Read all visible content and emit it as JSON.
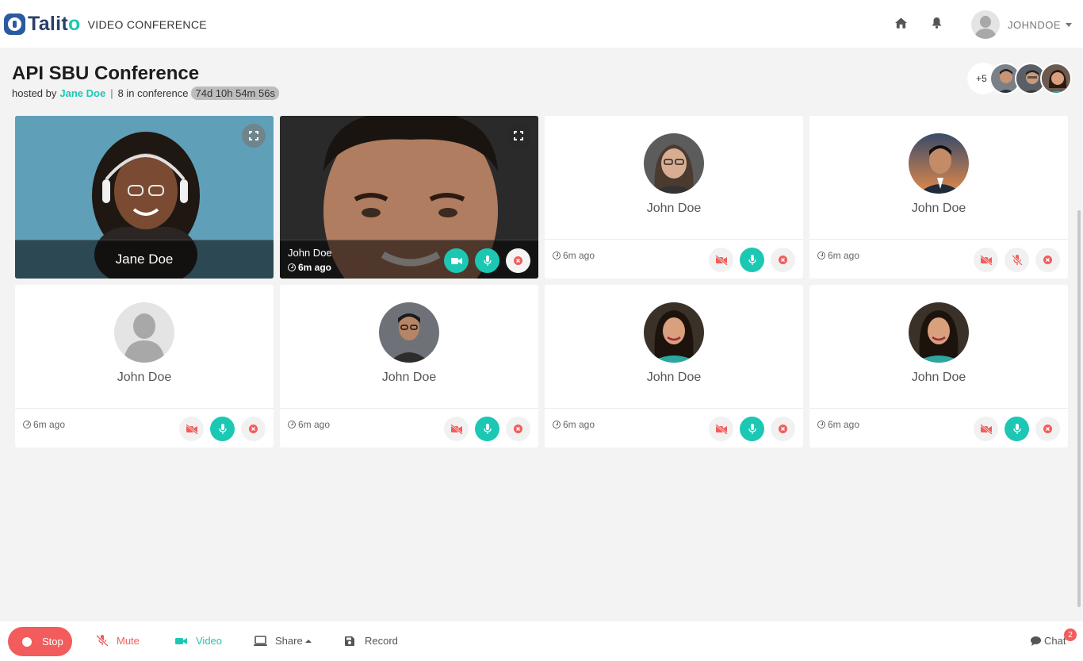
{
  "header": {
    "logo_text_main": "Talit",
    "logo_text_accent": "o",
    "app_label": "VIDEO CONFERENCE",
    "username": "JOHNDOE"
  },
  "conference": {
    "title": "API SBU Conference",
    "hosted_by_label": "hosted by",
    "host_name": "Jane Doe",
    "separator": "|",
    "count_text": "8 in conference",
    "timer": "74d 10h 54m 56s",
    "more_participants": "+5"
  },
  "tiles": [
    {
      "name": "Jane Doe",
      "time": "",
      "mode": "video"
    },
    {
      "name": "John Doe",
      "time": "6m ago",
      "mode": "video"
    },
    {
      "name": "John Doe",
      "time": "6m ago",
      "mode": "avatar"
    },
    {
      "name": "John Doe",
      "time": "6m ago",
      "mode": "avatar"
    },
    {
      "name": "John Doe",
      "time": "6m ago",
      "mode": "avatar"
    },
    {
      "name": "John Doe",
      "time": "6m ago",
      "mode": "avatar"
    },
    {
      "name": "John Doe",
      "time": "6m ago",
      "mode": "avatar"
    },
    {
      "name": "John Doe",
      "time": "6m ago",
      "mode": "avatar"
    }
  ],
  "bottombar": {
    "stop": "Stop",
    "mute": "Mute",
    "video": "Video",
    "share": "Share",
    "record": "Record",
    "chat": "Chat",
    "chat_badge": "2"
  },
  "colors": {
    "accent": "#1cc8b3",
    "danger": "#f25c5c",
    "brand": "#2a3f6a"
  }
}
